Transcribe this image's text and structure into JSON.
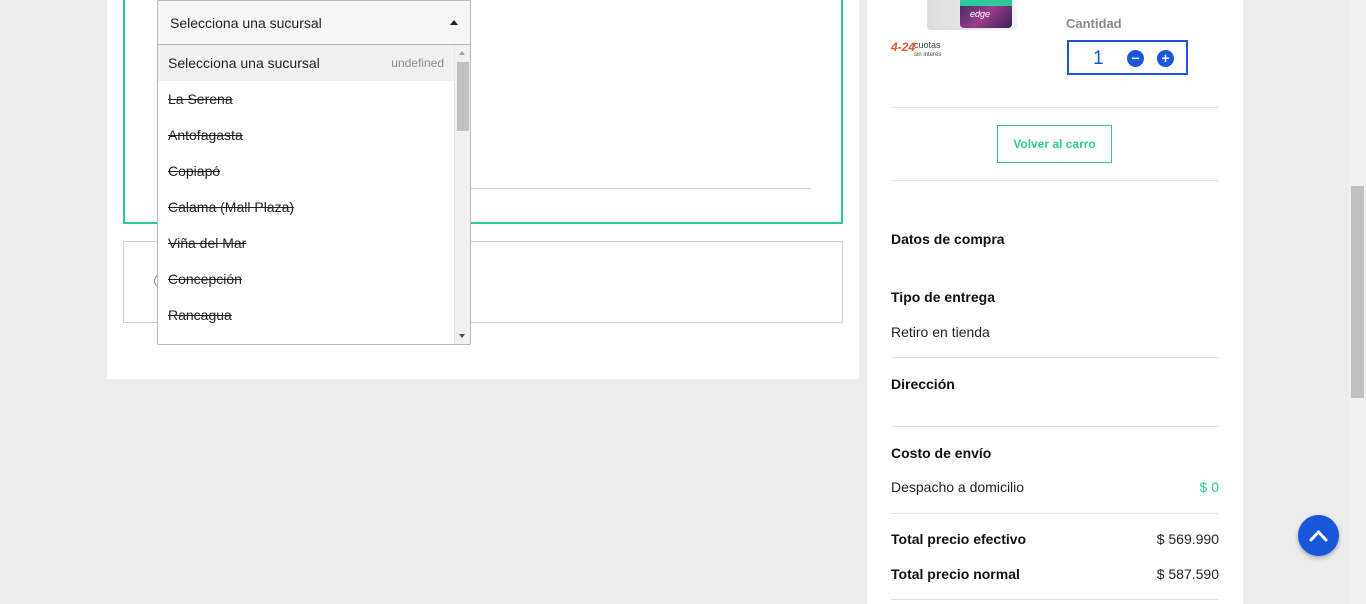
{
  "branch_select": {
    "selected_label": "Selecciona una sucursal",
    "options": [
      {
        "label": "Selecciona una sucursal",
        "meta": "undefined"
      },
      {
        "label": "La Serena"
      },
      {
        "label": "Antofagasta"
      },
      {
        "label": "Copiapó"
      },
      {
        "label": "Calama (Mall Plaza)"
      },
      {
        "label": "Viña del Mar"
      },
      {
        "label": "Concepción"
      },
      {
        "label": "Rancagua"
      }
    ]
  },
  "product": {
    "image_text": "edge",
    "cuotas_number": "4-24",
    "cuotas_text": "cuotas",
    "cuotas_subtext": "sin interés",
    "quantity_label": "Cantidad",
    "quantity_value": "1",
    "minus_symbol": "−",
    "plus_symbol": "+"
  },
  "cart": {
    "back_button": "Volver al carro"
  },
  "summary": {
    "title": "Datos de compra",
    "delivery_type_title": "Tipo de entrega",
    "delivery_type_value": "Retiro en tienda",
    "address_title": "Dirección",
    "shipping_title": "Costo de envío",
    "shipping_label": "Despacho a domicilio",
    "shipping_value": "$ 0",
    "total_cash_label": "Total precio efectivo",
    "total_cash_value": "$ 569.990",
    "total_normal_label": "Total precio normal",
    "total_normal_value": "$ 587.590"
  },
  "colors": {
    "accent_green": "#2ec99a",
    "accent_blue": "#1a56db"
  },
  "icons": {
    "scroll_to_top": "chevron-up-icon",
    "select_caret": "caret-up-icon"
  }
}
